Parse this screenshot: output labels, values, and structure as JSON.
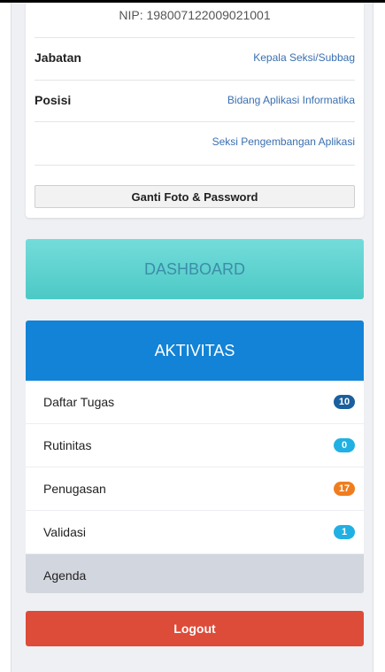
{
  "profile": {
    "nip": "NIP: 198007122009021001",
    "jabatan_label": "Jabatan",
    "jabatan_value": "Kepala Seksi/Subbag",
    "posisi_label": "Posisi",
    "posisi_value": "Bidang Aplikasi Informatika",
    "posisi_value_2": "Seksi Pengembangan Aplikasi",
    "change_button": "Ganti Foto & Password"
  },
  "dashboard": {
    "label": "DASHBOARD"
  },
  "aktivitas": {
    "title": "AKTIVITAS",
    "items": [
      {
        "label": "Daftar Tugas",
        "badge": "10",
        "badge_color": "#1a5f9e"
      },
      {
        "label": "Rutinitas",
        "badge": "0",
        "badge_color": "#21b0e3"
      },
      {
        "label": "Penugasan",
        "badge": "17",
        "badge_color": "#ef7d1f"
      },
      {
        "label": "Validasi",
        "badge": "1",
        "badge_color": "#21b0e3"
      },
      {
        "label": "Agenda"
      }
    ]
  },
  "logout": {
    "label": "Logout"
  },
  "colors": {
    "dashboard_bg": "#5ccfcc",
    "aktivitas_header": "#1283d6",
    "logout_bg": "#dd4b39",
    "selected_item_bg": "#d2d6de"
  }
}
